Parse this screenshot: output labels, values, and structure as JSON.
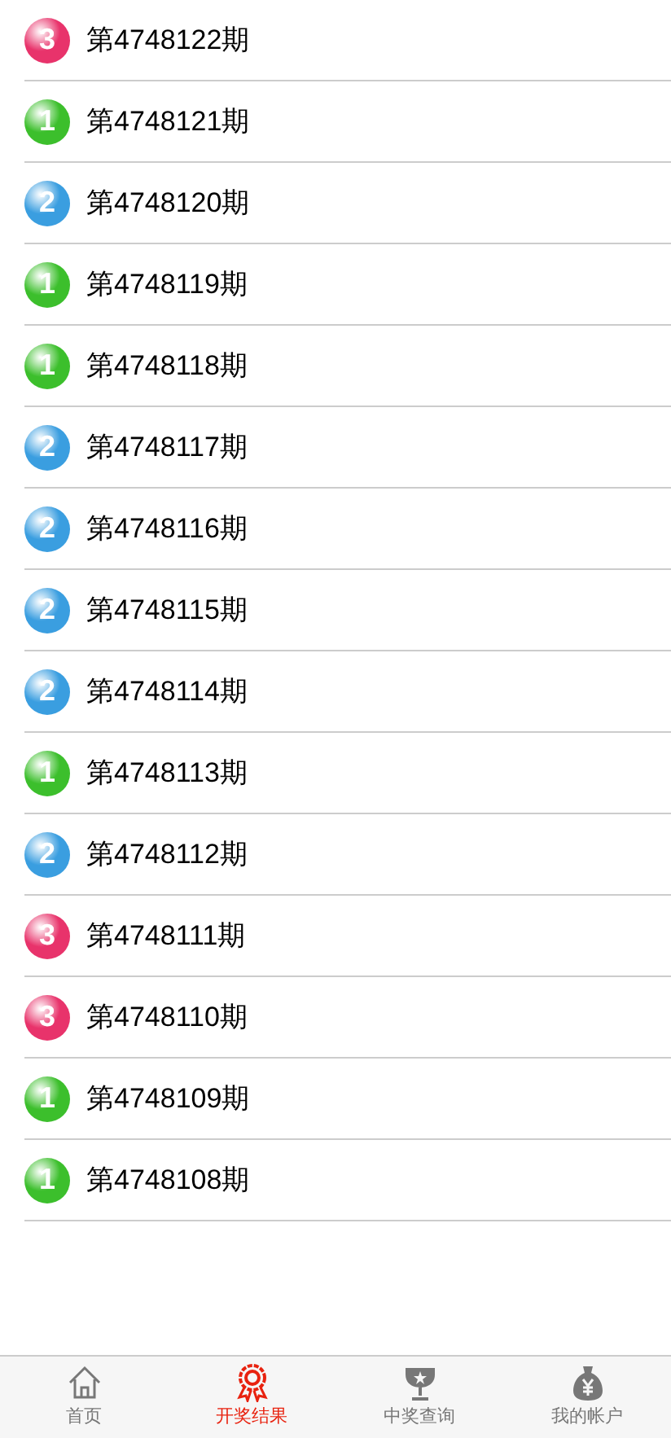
{
  "draws": [
    {
      "ball": "3",
      "color": "#e8336b",
      "period": "第4748122期"
    },
    {
      "ball": "1",
      "color": "#3cbf2c",
      "period": "第4748121期"
    },
    {
      "ball": "2",
      "color": "#3a9ee0",
      "period": "第4748120期"
    },
    {
      "ball": "1",
      "color": "#3cbf2c",
      "period": "第4748119期"
    },
    {
      "ball": "1",
      "color": "#3cbf2c",
      "period": "第4748118期"
    },
    {
      "ball": "2",
      "color": "#3a9ee0",
      "period": "第4748117期"
    },
    {
      "ball": "2",
      "color": "#3a9ee0",
      "period": "第4748116期"
    },
    {
      "ball": "2",
      "color": "#3a9ee0",
      "period": "第4748115期"
    },
    {
      "ball": "2",
      "color": "#3a9ee0",
      "period": "第4748114期"
    },
    {
      "ball": "1",
      "color": "#3cbf2c",
      "period": "第4748113期"
    },
    {
      "ball": "2",
      "color": "#3a9ee0",
      "period": "第4748112期"
    },
    {
      "ball": "3",
      "color": "#e8336b",
      "period": "第4748111期"
    },
    {
      "ball": "3",
      "color": "#e8336b",
      "period": "第4748110期"
    },
    {
      "ball": "1",
      "color": "#3cbf2c",
      "period": "第4748109期"
    },
    {
      "ball": "1",
      "color": "#3cbf2c",
      "period": "第4748108期"
    }
  ],
  "tab_bar": [
    {
      "kind": "home",
      "label": "首页",
      "selected": false
    },
    {
      "kind": "award",
      "label": "开奖结果",
      "selected": true
    },
    {
      "kind": "trophy",
      "label": "中奖查询",
      "selected": false
    },
    {
      "kind": "moneybag",
      "label": "我的帐户",
      "selected": false
    }
  ]
}
